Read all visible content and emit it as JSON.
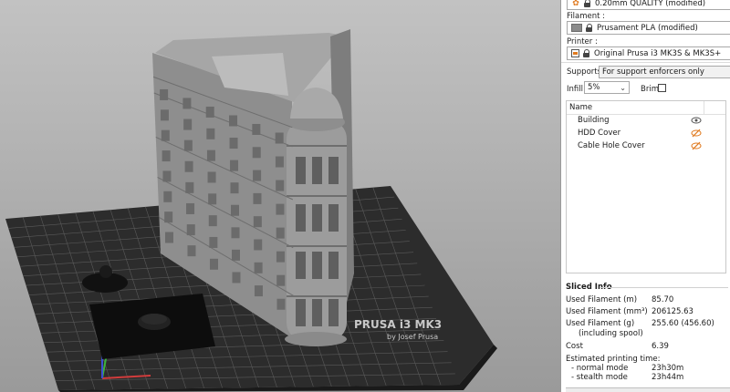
{
  "panel": {
    "print_settings": {
      "value": "0.20mm QUALITY (modified)"
    },
    "filament": {
      "label": "Filament :",
      "value": "Prusament PLA (modified)"
    },
    "printer": {
      "label": "Printer :",
      "value": "Original Prusa i3 MK3S & MK3S+"
    },
    "supports": {
      "label": "Supports:",
      "value": "For support enforcers only"
    },
    "infill": {
      "label": "Infill:",
      "value": "5%"
    },
    "brim": {
      "label": "Brim:",
      "checked": false
    },
    "objects": {
      "header": "Name",
      "items": [
        {
          "name": "Building",
          "icon": "eye-icon"
        },
        {
          "name": "HDD Cover",
          "icon": "eye-slash-icon"
        },
        {
          "name": "Cable Hole Cover",
          "icon": "eye-slash-icon"
        }
      ]
    },
    "sliced_info": {
      "title": "Sliced Info",
      "rows": [
        {
          "k": "Used Filament (m)",
          "v": "85.70"
        },
        {
          "k": "Used Filament (mm³)",
          "v": "206125.63"
        },
        {
          "k": "Used Filament (g)",
          "v": "255.60 (456.60)"
        },
        {
          "k": "(including spool)",
          "v": ""
        },
        {
          "k": "Cost",
          "v": "6.39"
        },
        {
          "k": "Estimated printing time:",
          "v": ""
        },
        {
          "k": " - normal mode",
          "v": "23h30m"
        },
        {
          "k": " - stealth mode",
          "v": "23h44m"
        }
      ]
    }
  },
  "bed": {
    "brand_line1": "PRUSA i3 MK3",
    "brand_line2": "by Josef Prusa"
  },
  "colors": {
    "accent": "#e07a1f",
    "bed": "#2b2b2b",
    "model": "#9d9d9d"
  }
}
